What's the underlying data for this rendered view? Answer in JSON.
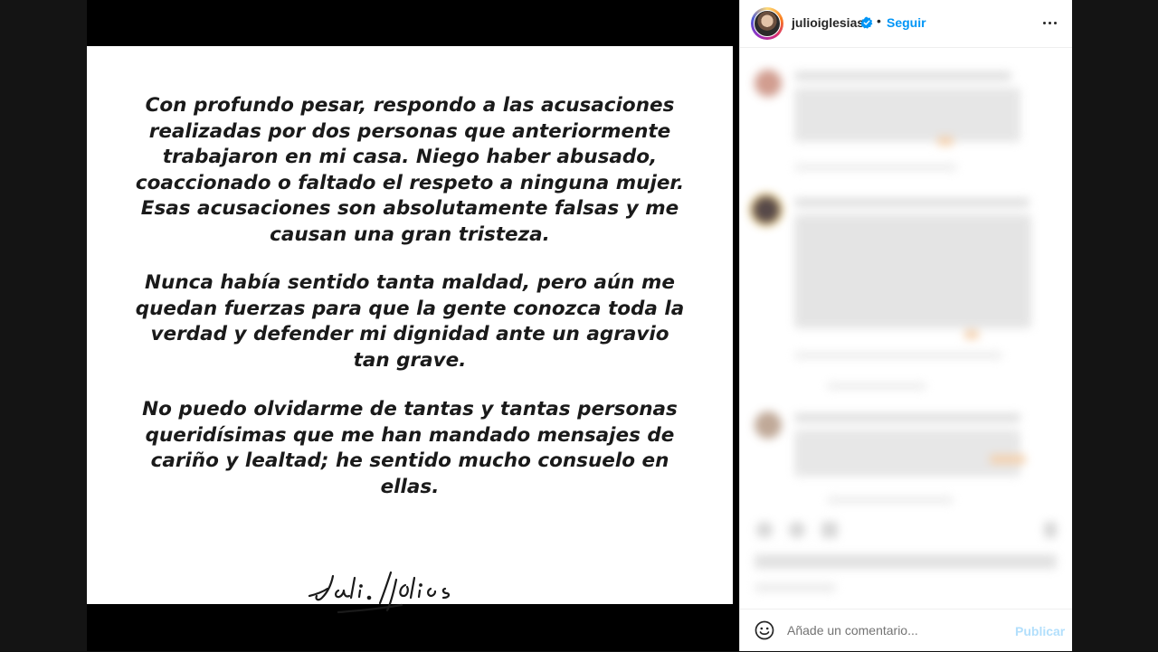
{
  "statement": {
    "paragraphs": [
      [
        "Con profundo pesar, respondo a las acusaciones",
        "realizadas por dos personas que anteriormente",
        "trabajaron en mi casa. Niego haber abusado,",
        "coaccionado o faltado el respeto a ninguna mujer.",
        "Esas acusaciones son absolutamente falsas y me",
        "causan una gran tristeza."
      ],
      [
        "Nunca había sentido tanta maldad, pero aún me",
        "quedan fuerzas para que la gente conozca toda la",
        "verdad y defender mi dignidad ante un agravio",
        "tan grave."
      ],
      [
        "No puedo olvidarme de tantas y tantas personas",
        "queridísimas que me han mandado mensajes de",
        "cariño y lealtad; he sentido mucho consuelo en",
        "ellas."
      ]
    ]
  },
  "header": {
    "username": "julioiglesias",
    "separator": "•",
    "follow_label": "Seguir",
    "more_icon": "more-horizontal-icon",
    "verified_color": "#0095f6"
  },
  "composer": {
    "placeholder": "Añade un comentario...",
    "publish_label": "Publicar",
    "emoji_icon": "smiley-icon"
  },
  "colors": {
    "link": "#0095f6",
    "publish_disabled": "#b2dffc",
    "text": "#262626"
  }
}
